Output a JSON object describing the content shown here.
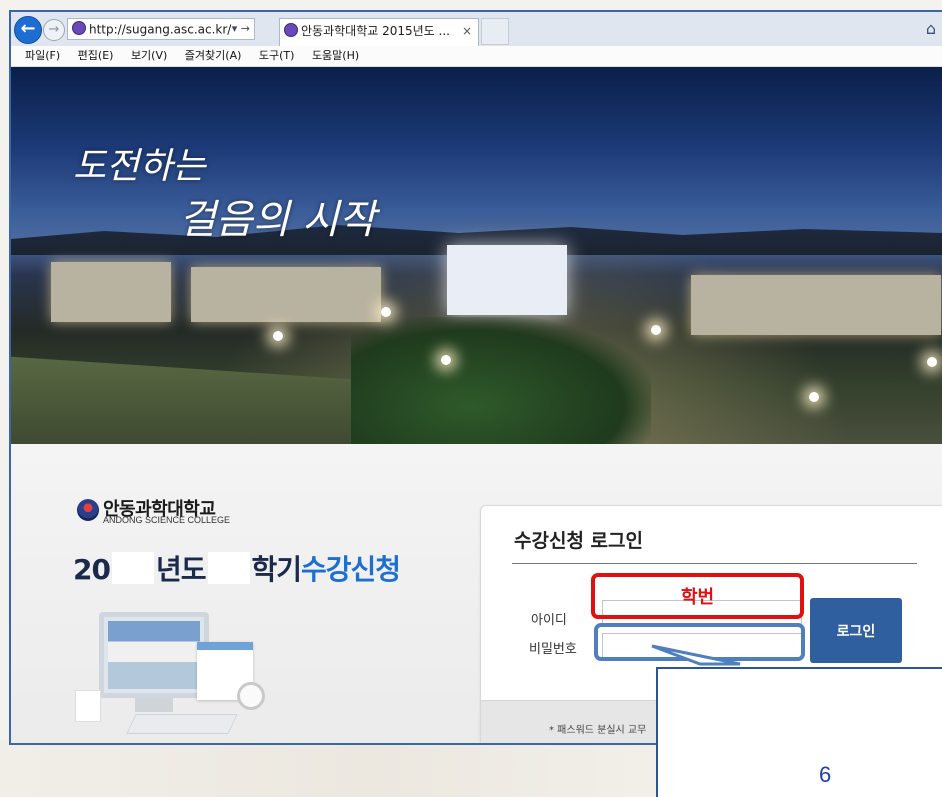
{
  "browser": {
    "url": "http://sugang.asc.ac.kr/",
    "addr_controls": "▾ →",
    "tab_title": "안동과학대학교 2015년도 ...",
    "tab_close": "×",
    "menu": [
      "파일(F)",
      "편집(E)",
      "보기(V)",
      "즐겨찾기(A)",
      "도구(T)",
      "도움말(H)"
    ]
  },
  "hero": {
    "slogan_line1": "도전하는",
    "slogan_line2": "걸음의 시작"
  },
  "school": {
    "name_ko": "안동과학대학교",
    "name_en": "ANDONG SCIENCE COLLEGE"
  },
  "registration": {
    "prefix": "20",
    "year_word": "년도",
    "term_word": "학기",
    "accent_word": "수강신청"
  },
  "login": {
    "title": "수강신청 로그인",
    "id_label": "아이디",
    "pw_label": "비밀번호",
    "button_label": "로그인",
    "footer_note": "* 패스워드 분실시 교무"
  },
  "annotations": {
    "id_hint": "학번",
    "callout_number": "6"
  },
  "colors": {
    "accent_blue": "#1e6fd0",
    "login_button": "#2f5f9e",
    "annotation_red": "#e01010",
    "annotation_blue": "#4f7fbf"
  }
}
